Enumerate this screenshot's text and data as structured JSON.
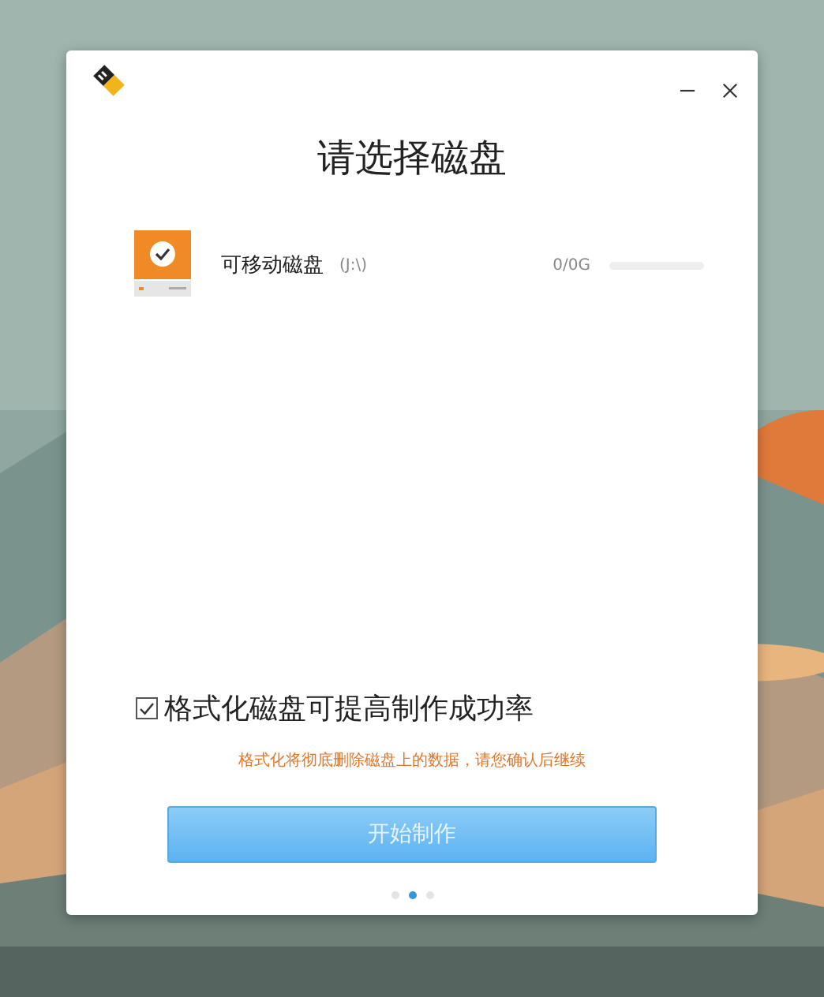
{
  "dialog": {
    "title": "请选择磁盘",
    "disks": [
      {
        "name": "可移动磁盘",
        "drive": "(J:\\)",
        "size": "0/0G",
        "selected": true
      }
    ],
    "format_option": {
      "label": "格式化磁盘可提高制作成功率",
      "checked": true
    },
    "warning": "格式化将彻底删除磁盘上的数据，请您确认后继续",
    "start_button": "开始制作",
    "pages": [
      {
        "selected": false
      },
      {
        "selected": true
      },
      {
        "selected": false
      }
    ]
  }
}
